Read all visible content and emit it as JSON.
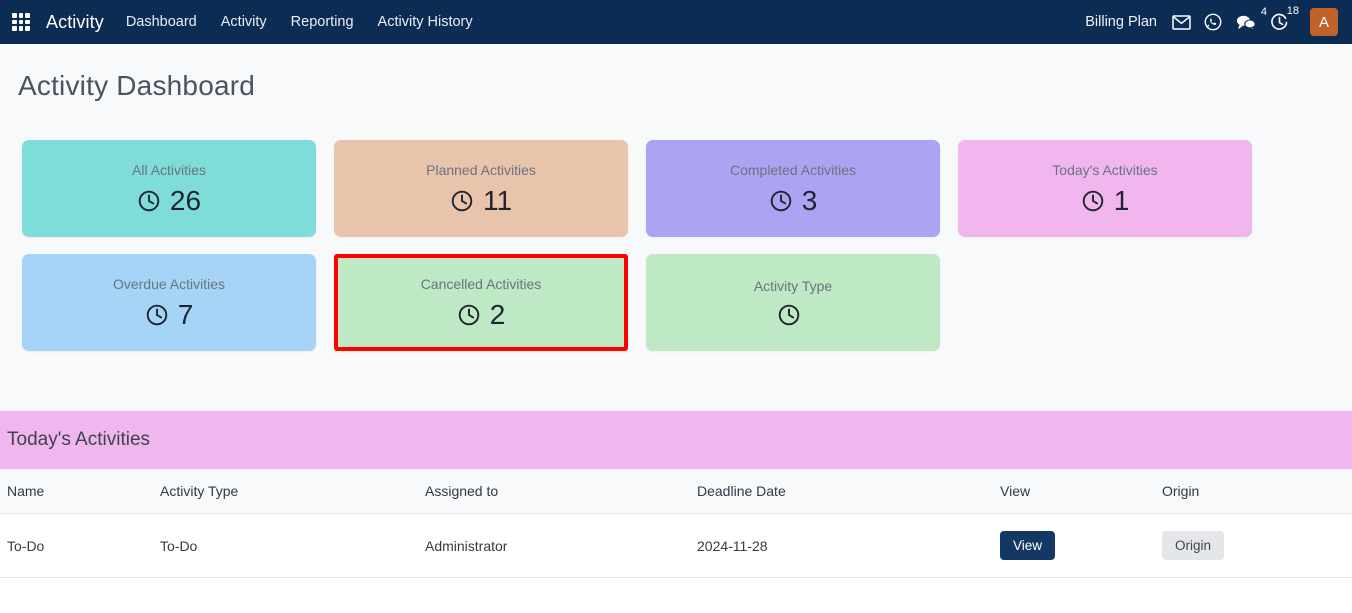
{
  "navbar": {
    "apps_icon": "apps-grid-icon",
    "brand": "Activity",
    "links": [
      {
        "label": "Dashboard"
      },
      {
        "label": "Activity"
      },
      {
        "label": "Reporting"
      },
      {
        "label": "Activity History"
      }
    ],
    "billing_label": "Billing Plan",
    "icons": [
      {
        "name": "mail-icon",
        "badge": ""
      },
      {
        "name": "whatsapp-icon",
        "badge": ""
      },
      {
        "name": "messages-icon",
        "badge": "4"
      },
      {
        "name": "activity-clock-icon",
        "badge": "18"
      }
    ],
    "avatar_initial": "A",
    "avatar_color": "#c0632a",
    "background": "#0d2c53"
  },
  "page": {
    "title": "Activity Dashboard"
  },
  "cards": [
    {
      "title": "All Activities",
      "value": "26",
      "color": "#7eddd8",
      "icon": "clock-icon",
      "highlight": false
    },
    {
      "title": "Planned Activities",
      "value": "11",
      "color": "#e9c4ac",
      "icon": "clock-icon",
      "highlight": false
    },
    {
      "title": "Completed Activities",
      "value": "3",
      "color": "#aba4f2",
      "icon": "clock-icon",
      "highlight": false
    },
    {
      "title": "Today's Activities",
      "value": "1",
      "color": "#f2b6ef",
      "icon": "clock-icon",
      "highlight": false
    },
    {
      "title": "Overdue Activities",
      "value": "7",
      "color": "#a6d4f7",
      "icon": "clock-icon",
      "highlight": false
    },
    {
      "title": "Cancelled Activities",
      "value": "2",
      "color": "#bfe8c4",
      "icon": "clock-icon",
      "highlight": true,
      "highlight_color": "#ff0000"
    },
    {
      "title": "Activity Type",
      "value": "",
      "color": "#bfe8c4",
      "icon": "clock-icon",
      "highlight": false
    }
  ],
  "table_section": {
    "heading": "Today's Activities",
    "heading_background": "#f0b7ee",
    "columns": [
      "Name",
      "Activity Type",
      "Assigned to",
      "Deadline Date",
      "View",
      "Origin"
    ],
    "rows": [
      {
        "name": "To-Do",
        "activity_type": "To-Do",
        "assigned_to": "Administrator",
        "deadline_date": "2024-11-28",
        "view_label": "View",
        "origin_label": "Origin"
      }
    ]
  }
}
